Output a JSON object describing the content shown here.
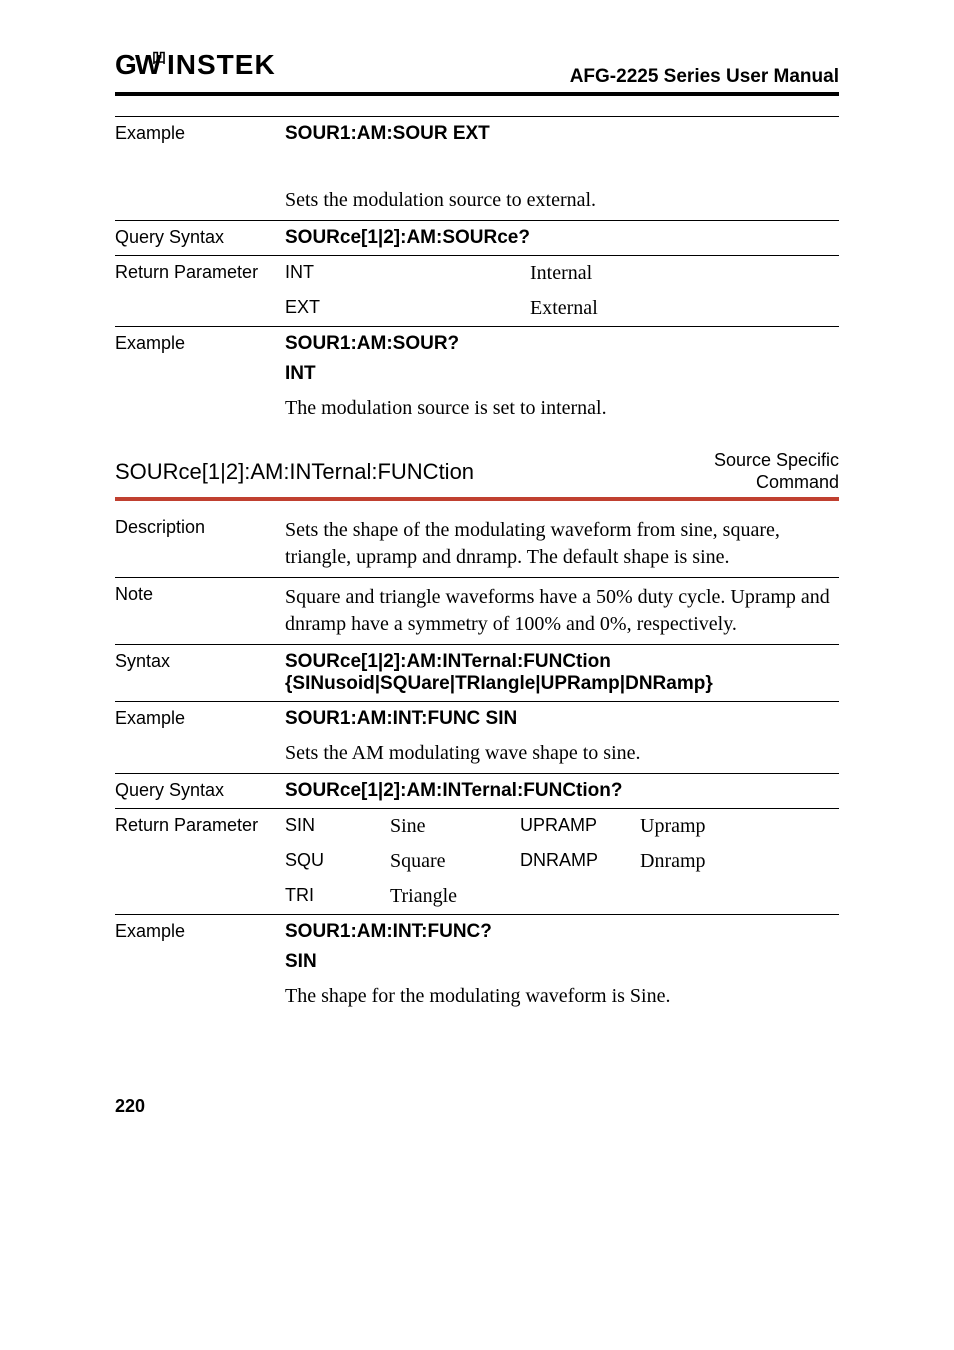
{
  "header": {
    "logo": "GWINSTEK",
    "manual_title": "AFG-2225 Series User Manual"
  },
  "section1": {
    "example_label": "Example",
    "example_cmd": "SOUR1:AM:SOUR EXT",
    "example_desc": "Sets the modulation source to external.",
    "query_syntax_label": "Query Syntax",
    "query_syntax": "SOURce[1|2]:AM:SOURce?",
    "return_param_label": "Return Parameter",
    "return_params": [
      {
        "code": "INT",
        "desc": "Internal"
      },
      {
        "code": "EXT",
        "desc": "External"
      }
    ],
    "example2_label": "Example",
    "example2_cmd": "SOUR1:AM:SOUR?",
    "example2_resp": "INT",
    "example2_desc": "The modulation source is set to internal."
  },
  "section2": {
    "heading": "SOURce[1|2]:AM:INTernal:FUNCtion",
    "tag_line1": "Source Specific",
    "tag_line2": "Command",
    "description_label": "Description",
    "description": "Sets the shape of the modulating waveform from sine, square, triangle, upramp and dnramp. The default shape is sine.",
    "note_label": "Note",
    "note": "Square and triangle waveforms have a 50% duty cycle. Upramp and dnramp have a symmetry of 100% and 0%, respectively.",
    "syntax_label": "Syntax",
    "syntax_line1": "SOURce[1|2]:AM:INTernal:FUNCtion",
    "syntax_line2": "{SINusoid|SQUare|TRIangle|UPRamp|DNRamp}",
    "example_label": "Example",
    "example_cmd": "SOUR1:AM:INT:FUNC SIN",
    "example_desc": "Sets the AM modulating wave shape to sine.",
    "query_syntax_label": "Query Syntax",
    "query_syntax": "SOURce[1|2]:AM:INTernal:FUNCtion?",
    "return_param_label": "Return Parameter",
    "return_params": [
      {
        "code": "SIN",
        "desc": "Sine",
        "code2": "UPRAMP",
        "desc2": "Upramp"
      },
      {
        "code": "SQU",
        "desc": "Square",
        "code2": "DNRAMP",
        "desc2": "Dnramp"
      },
      {
        "code": "TRI",
        "desc": "Triangle",
        "code2": "",
        "desc2": ""
      }
    ],
    "example2_label": "Example",
    "example2_cmd": "SOUR1:AM:INT:FUNC?",
    "example2_resp": "SIN",
    "example2_desc": "The shape for the modulating waveform is Sine."
  },
  "page_number": "220"
}
